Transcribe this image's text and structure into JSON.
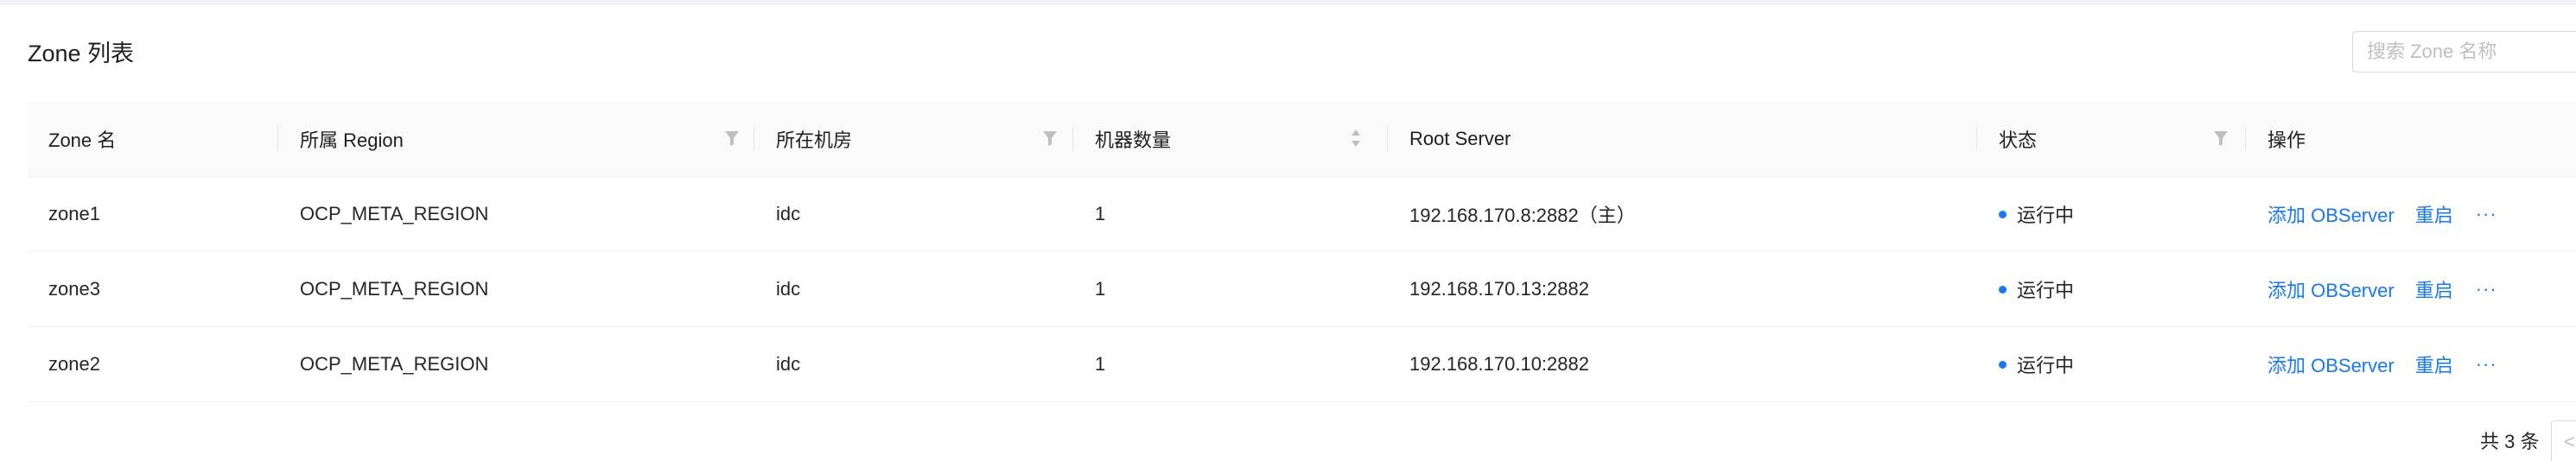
{
  "page": {
    "title": "Zone 列表"
  },
  "search": {
    "placeholder": "搜索 Zone 名称"
  },
  "table": {
    "columns": {
      "zone_name": "Zone 名",
      "region": "所属 Region",
      "idc": "所在机房",
      "machine_count": "机器数量",
      "root_server": "Root Server",
      "status": "状态",
      "actions": "操作"
    },
    "rows": [
      {
        "zone_name": "zone1",
        "region": "OCP_META_REGION",
        "idc": "idc",
        "machine_count": "1",
        "root_server": "192.168.170.8:2882（主）",
        "status": "运行中",
        "action_add": "添加 OBServer",
        "action_restart": "重启",
        "action_more": "···"
      },
      {
        "zone_name": "zone3",
        "region": "OCP_META_REGION",
        "idc": "idc",
        "machine_count": "1",
        "root_server": "192.168.170.13:2882",
        "status": "运行中",
        "action_add": "添加 OBServer",
        "action_restart": "重启",
        "action_more": "···"
      },
      {
        "zone_name": "zone2",
        "region": "OCP_META_REGION",
        "idc": "idc",
        "machine_count": "1",
        "root_server": "192.168.170.10:2882",
        "status": "运行中",
        "action_add": "添加 OBServer",
        "action_restart": "重启",
        "action_more": "···"
      }
    ]
  },
  "pagination": {
    "total_text": "共 3 条",
    "prev_glyph": "<"
  },
  "colors": {
    "link": "#1677ff",
    "status_running": "#1677ff",
    "header_bg": "#fafafa",
    "border": "#f0f0f0"
  },
  "icons": {
    "filter": "filter-icon",
    "sort": "sort-icon",
    "more": "more-icon",
    "status_dot": "status-dot-icon"
  }
}
